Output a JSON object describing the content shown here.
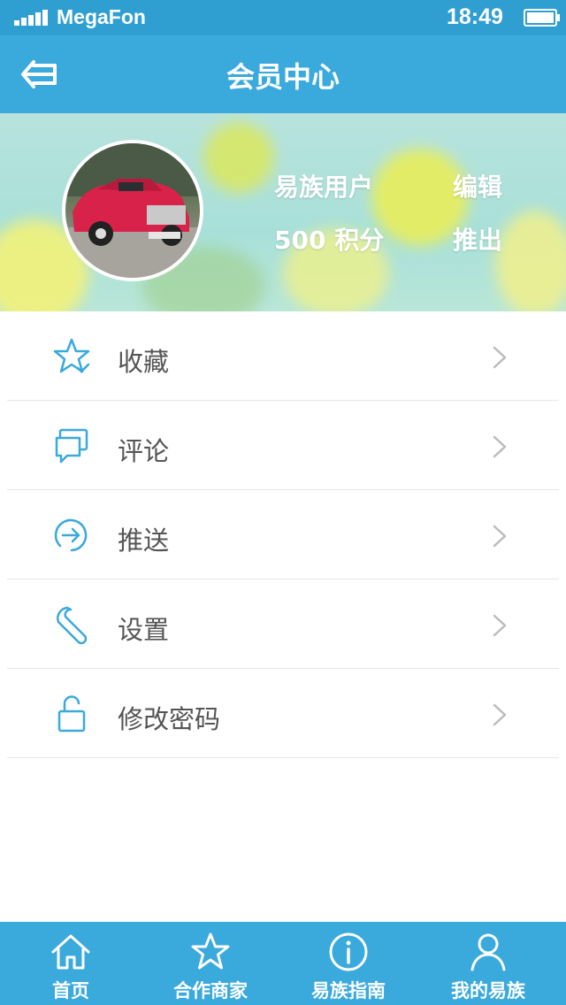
{
  "status_bar": {
    "carrier": "MegaFon",
    "time": "18:49"
  },
  "nav": {
    "title": "会员中心"
  },
  "profile": {
    "name": "易族用户",
    "points": "500 积分",
    "edit": "编辑",
    "logout": "推出"
  },
  "menu": [
    {
      "label": "收藏",
      "icon": "star-check-icon"
    },
    {
      "label": "评论",
      "icon": "comment-icon"
    },
    {
      "label": "推送",
      "icon": "push-arrow-icon"
    },
    {
      "label": "设置",
      "icon": "wrench-icon"
    },
    {
      "label": "修改密码",
      "icon": "unlock-icon"
    }
  ],
  "tabs": [
    {
      "label": "首页",
      "icon": "home-icon"
    },
    {
      "label": "合作商家",
      "icon": "star-icon"
    },
    {
      "label": "易族指南",
      "icon": "info-icon"
    },
    {
      "label": "我的易族",
      "icon": "user-icon"
    }
  ],
  "colors": {
    "primary": "#3aa9dc",
    "status_bar": "#2f9fd2",
    "icon": "#3aa9dc",
    "text": "#555555"
  }
}
